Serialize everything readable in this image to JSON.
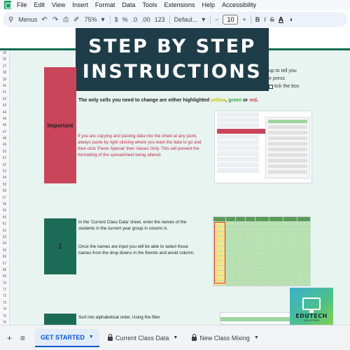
{
  "menu": {
    "items": [
      "File",
      "Edit",
      "View",
      "Insert",
      "Format",
      "Data",
      "Tools",
      "Extensions",
      "Help",
      "Accessibility"
    ]
  },
  "toolbar": {
    "menus_label": "Menus",
    "zoom": "75%",
    "currency": "$",
    "percent": "%",
    "decimal_decrease": ".0",
    "decimal_increase": ".00",
    "number_format": "123",
    "font": "Defaul...",
    "font_size": "10",
    "bold": "B",
    "italic": "I",
    "text_color": "A"
  },
  "title": {
    "line1": "STEP BY STEP",
    "line2": "INSTRUCTIONS"
  },
  "right_note": {
    "line1": "up to tell you",
    "line2": "e press",
    "line3": "tick the box"
  },
  "important": {
    "label": "Important",
    "highlight_prefix": "The only cells you need to change are either highlighted",
    "yellow": "yellow",
    "comma": ",",
    "green": "green",
    "or": "or",
    "red": "red",
    "period": ".",
    "copy_note": "If you are copying and pasting data into the sheet at any point, always paste by right clicking where you want the data to go and then click 'Paste Special' then Values Only. This will prevent the formatting of the spreadsheet being altered."
  },
  "step1": {
    "number": "1",
    "text1": "In the 'Current Class Data' sheet, enter the names of the students in the current year group in column A.",
    "text2": "Once the names are input you will be able to select those names from the drop downs in the friends and avoid column."
  },
  "step2": {
    "text": "Sort into alphabetical order. Using the filter"
  },
  "logo": {
    "name": "EDUTECH",
    "sub": "SOLUTIONS"
  },
  "tabs": {
    "add": "+",
    "list": "≡",
    "items": [
      {
        "label": "GET STARTED",
        "active": true,
        "locked": false
      },
      {
        "label": "Current Class Data",
        "active": false,
        "locked": true
      },
      {
        "label": "New Class Mixing",
        "active": false,
        "locked": true
      }
    ]
  },
  "row_numbers": [
    "35",
    "36",
    "37",
    "38",
    "39",
    "40",
    "41",
    "42",
    "43",
    "44",
    "45",
    "46",
    "47",
    "48",
    "49",
    "50",
    "51",
    "52",
    "53",
    "54",
    "55",
    "56",
    "57",
    "58",
    "59",
    "60",
    "61",
    "62",
    "63",
    "64",
    "65",
    "66",
    "67",
    "68",
    "69",
    "70",
    "71",
    "72",
    "73",
    "74",
    "75",
    "76"
  ],
  "colors": {
    "banner": "#1f3d49",
    "important": "#c8455a",
    "step": "#1c6b57",
    "sheet_bg": "#e8f4f0",
    "active_tab": "#0b57d0"
  }
}
